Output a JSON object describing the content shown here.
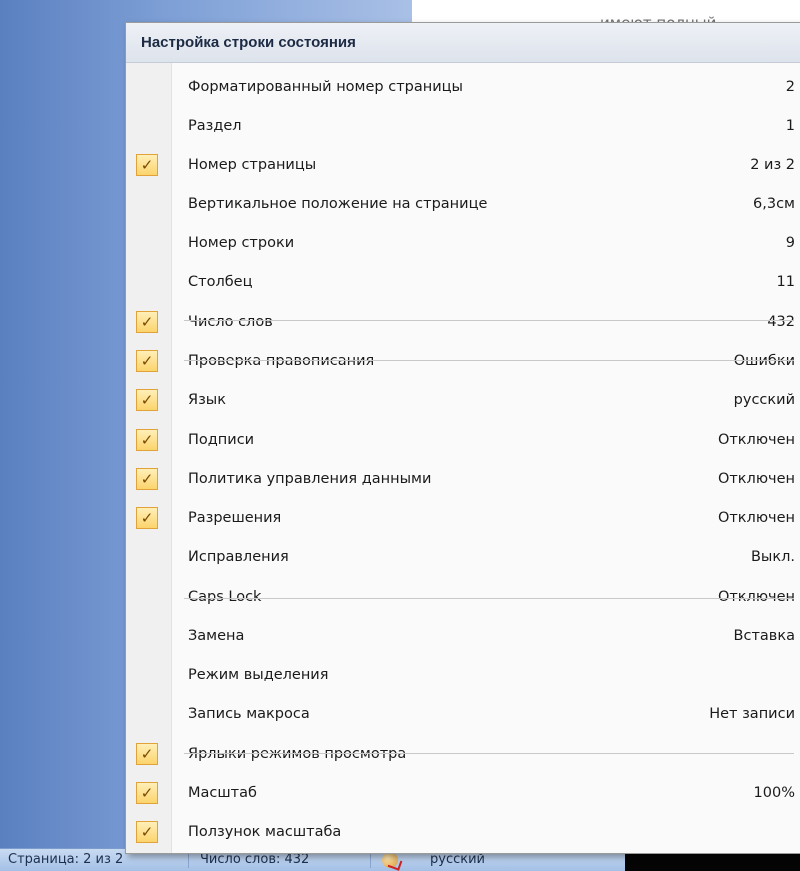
{
  "document": {
    "visible_text": "имеют полный"
  },
  "menu": {
    "title": "Настройка строки состояния",
    "items": [
      {
        "label": "Форматированный номер страницы",
        "value": "2",
        "checked": false
      },
      {
        "label": "Раздел",
        "value": "1",
        "checked": false
      },
      {
        "label": "Номер страницы",
        "value": "2 из 2",
        "checked": true
      },
      {
        "label": "Вертикальное положение на странице",
        "value": "6,3см",
        "checked": false
      },
      {
        "label": "Номер строки",
        "value": "9",
        "checked": false
      },
      {
        "label": "Столбец",
        "value": "11",
        "checked": false
      },
      {
        "label": "Число слов",
        "value": "432",
        "checked": true
      },
      {
        "label": "Проверка правописания",
        "value": "Ошибки",
        "checked": true
      },
      {
        "label": "Язык",
        "value": "русский",
        "checked": true
      },
      {
        "label": "Подписи",
        "value": "Отключен",
        "checked": true
      },
      {
        "label": "Политика управления данными",
        "value": "Отключен",
        "checked": true
      },
      {
        "label": "Разрешения",
        "value": "Отключен",
        "checked": true
      },
      {
        "label": "Исправления",
        "value": "Выкл.",
        "checked": false
      },
      {
        "label": "Caps Lock",
        "value": "Отключен",
        "checked": false
      },
      {
        "label": "Замена",
        "value": "Вставка",
        "checked": false
      },
      {
        "label": "Режим выделения",
        "value": "",
        "checked": false
      },
      {
        "label": "Запись макроса",
        "value": "Нет записи",
        "checked": false
      },
      {
        "label": "Ярлыки режимов просмотра",
        "value": "",
        "checked": true
      },
      {
        "label": "Масштаб",
        "value": "100%",
        "checked": true
      },
      {
        "label": "Ползунок масштаба",
        "value": "",
        "checked": true
      }
    ]
  },
  "statusbar": {
    "page": "Страница: 2 из 2",
    "words": "Число слов: 432",
    "language": "русский"
  },
  "icons": {
    "checkmark": "checkmark-icon",
    "spelling": "spelling-status-icon"
  },
  "colors": {
    "check_bg": "#fbd46c",
    "check_border": "#e2a23a",
    "doc_side": "#7d9fd6"
  }
}
